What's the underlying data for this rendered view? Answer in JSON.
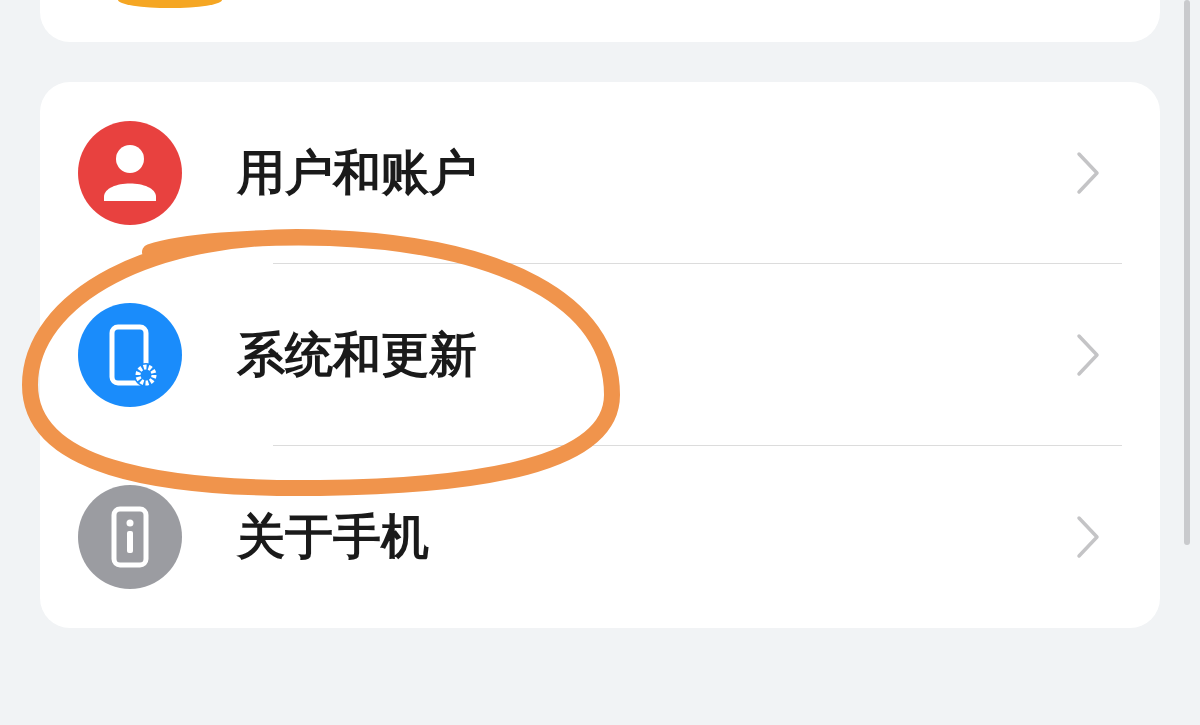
{
  "settings_group": {
    "items": [
      {
        "label": "用户和账户",
        "kind": "user",
        "color": "#e8413f"
      },
      {
        "label": "系统和更新",
        "kind": "system",
        "color": "#1a8cfb"
      },
      {
        "label": "关于手机",
        "kind": "info",
        "color": "#9b9ca1"
      }
    ]
  },
  "annotation": {
    "kind": "circle",
    "color": "#f0944c"
  }
}
